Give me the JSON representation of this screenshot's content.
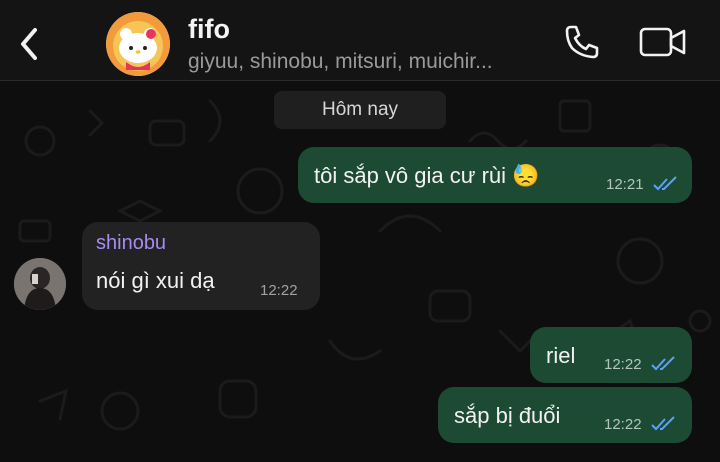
{
  "header": {
    "title": "fifo",
    "members": "giyuu, shinobu, mitsuri, muichir..."
  },
  "chat": {
    "date_divider": "Hôm nay",
    "messages": [
      {
        "direction": "outgoing",
        "text": "tôi sắp vô gia cư rùi 😓",
        "time": "12:21",
        "status": "read"
      },
      {
        "direction": "incoming",
        "sender": "shinobu",
        "text": "nói gì xui dạ",
        "time": "12:22"
      },
      {
        "direction": "outgoing",
        "text": "riel",
        "time": "12:22",
        "status": "read"
      },
      {
        "direction": "outgoing",
        "text": "sắp bị đuổi",
        "time": "12:22",
        "status": "read"
      }
    ]
  },
  "colors": {
    "outgoing_bubble": "#1d4a33",
    "incoming_bubble": "#222222",
    "sender_name": "#a78bf3",
    "read_ticks": "#5aa0ff"
  },
  "icons": [
    "back-chevron-icon",
    "phone-icon",
    "video-camera-icon",
    "double-check-icon"
  ]
}
